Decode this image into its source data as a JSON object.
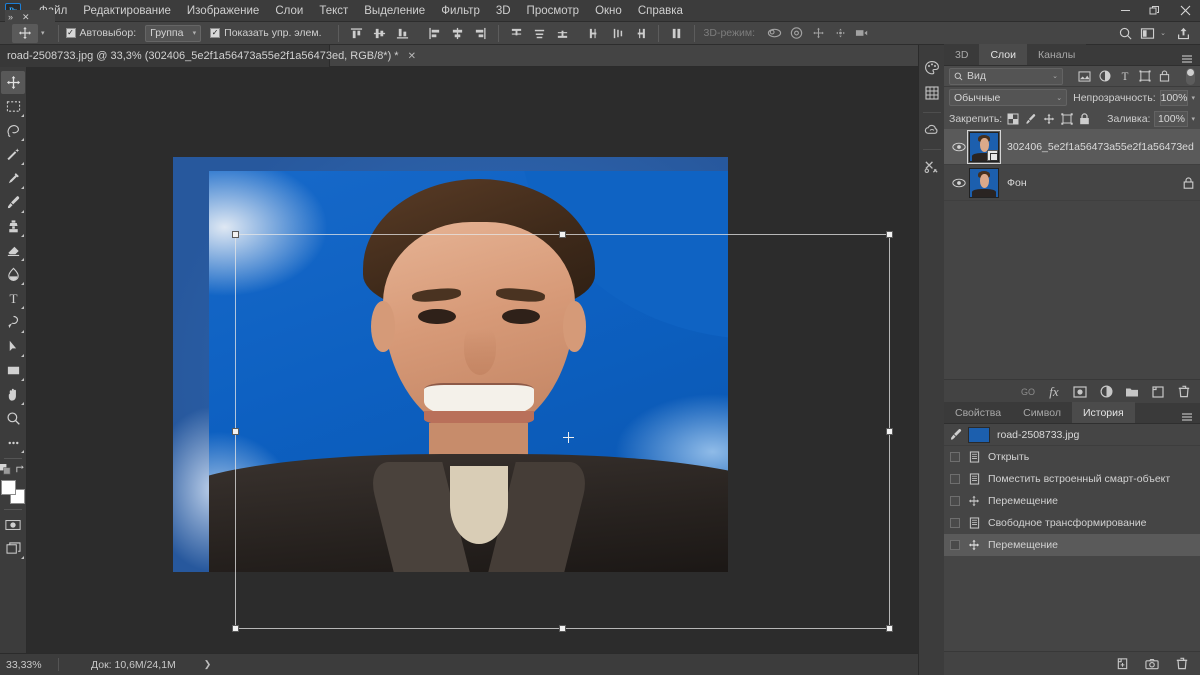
{
  "app": {
    "logo": "Ps"
  },
  "menubar": {
    "items": [
      "Файл",
      "Редактирование",
      "Изображение",
      "Слои",
      "Текст",
      "Выделение",
      "Фильтр",
      "3D",
      "Просмотр",
      "Окно",
      "Справка"
    ],
    "window_controls": {
      "minimize": "—",
      "restore": "❐",
      "close": "✕"
    }
  },
  "options_bar": {
    "tool_icon": "move-tool-icon",
    "auto_select_label": "Автовыбор:",
    "auto_select_checked": true,
    "auto_select_scope": "Группа",
    "show_controls_label": "Показать упр. элем.",
    "show_controls_checked": true,
    "align_icons": [
      "align-top-edges-icon",
      "align-vertical-centers-icon",
      "align-bottom-edges-icon",
      "align-left-edges-icon",
      "align-horizontal-centers-icon",
      "align-right-edges-icon"
    ],
    "distribute_icons": [
      "distribute-top-edges-icon",
      "distribute-vertical-centers-icon",
      "distribute-bottom-edges-icon",
      "distribute-left-edges-icon",
      "distribute-horizontal-centers-icon",
      "distribute-right-edges-icon"
    ],
    "arrange_icon": "arrange-icon",
    "mode_3d_label": "3D-режим:",
    "mode_3d_icons": [
      "orbit-3d-icon",
      "roll-3d-icon",
      "pan-3d-icon",
      "slide-3d-icon",
      "camera-3d-icon"
    ]
  },
  "header_right": {
    "search_icon": "search-icon",
    "workspace_icon": "workspace-switcher-icon",
    "workspace_caret": "⌄",
    "share_icon": "share-icon"
  },
  "document_tab": {
    "title": "road-2508733.jpg @ 33,3% (302406_5e2f1a56473a55e2f1a56473ed, RGB/8*) *",
    "close": "✕",
    "dock_expand": "»",
    "dock_close": "✕"
  },
  "toolbar": {
    "tools": [
      {
        "name": "move-tool",
        "active": true,
        "has_flyout": false
      },
      {
        "name": "rectangular-marquee-tool",
        "active": false,
        "has_flyout": true
      },
      {
        "name": "lasso-tool",
        "active": false,
        "has_flyout": true
      },
      {
        "name": "magic-wand-tool",
        "active": false,
        "has_flyout": true
      },
      {
        "name": "eyedropper-tool",
        "active": false,
        "has_flyout": true
      },
      {
        "name": "brush-tool",
        "active": false,
        "has_flyout": true
      },
      {
        "name": "clone-stamp-tool",
        "active": false,
        "has_flyout": true
      },
      {
        "name": "eraser-tool",
        "active": false,
        "has_flyout": true
      },
      {
        "name": "gradient-tool",
        "active": false,
        "has_flyout": true
      },
      {
        "name": "type-tool",
        "active": false,
        "has_flyout": true
      },
      {
        "name": "pen-tool",
        "active": false,
        "has_flyout": true
      },
      {
        "name": "path-selection-tool",
        "active": false,
        "has_flyout": true
      },
      {
        "name": "rectangle-tool",
        "active": false,
        "has_flyout": true
      },
      {
        "name": "hand-tool",
        "active": false,
        "has_flyout": true
      },
      {
        "name": "zoom-tool",
        "active": false,
        "has_flyout": false
      },
      {
        "name": "edit-toolbar-tool",
        "active": false,
        "has_flyout": false
      }
    ],
    "swap_colors_icon": "swap-colors-icon",
    "default_colors_icon": "default-colors-icon",
    "foreground_color": "#ffffff",
    "background_color": "#ffffff",
    "quick_mask_icon": "quick-mask-icon",
    "screen_mode_icon": "screen-mode-icon"
  },
  "canvas": {
    "transform_active": true,
    "center_mark": "transform-center-point"
  },
  "status_bar": {
    "zoom": "33,33%",
    "doc_info": "Док: 10,6M/24,1M",
    "arrow": "❯"
  },
  "icon_dock": {
    "items": [
      "color-panel-icon",
      "libraries-icon",
      "creative-cloud-icon",
      "tools-icon"
    ]
  },
  "layers_panel": {
    "tabs": [
      {
        "label": "3D",
        "active": false
      },
      {
        "label": "Слои",
        "active": true
      },
      {
        "label": "Каналы",
        "active": false
      }
    ],
    "menu_icon": "panel-menu-icon",
    "filter_value": "Вид",
    "filter_search_icon": "search-icon",
    "filter_caret": "⌄",
    "filter_icons": [
      "filter-pixel-icon",
      "filter-adjustment-icon",
      "filter-type-icon",
      "filter-shape-icon",
      "filter-smart-object-icon"
    ],
    "filter_toggle": "filter-enable-toggle",
    "blend_mode": "Обычные",
    "blend_caret": "⌄",
    "opacity_label": "Непрозрачность:",
    "opacity_value": "100%",
    "lock_label": "Закрепить:",
    "lock_icons": [
      "lock-transparent-pixels-icon",
      "lock-image-pixels-icon",
      "lock-position-icon",
      "lock-artboard-nesting-icon",
      "lock-all-icon"
    ],
    "fill_label": "Заливка:",
    "fill_value": "100%",
    "layers": [
      {
        "name": "302406_5e2f1a56473a55e2f1a56473ed",
        "visible": true,
        "selected": true,
        "smart_object": true,
        "locked": false
      },
      {
        "name": "Фон",
        "visible": true,
        "selected": false,
        "smart_object": false,
        "locked": true
      }
    ],
    "footer_icons": [
      "link-layers-icon",
      "layer-styles-icon",
      "layer-mask-icon",
      "adjustment-layer-icon",
      "new-group-icon",
      "new-layer-icon",
      "delete-layer-icon"
    ],
    "footer_link_label": "GO",
    "footer_fx_label": "fx"
  },
  "history_panel": {
    "tabs": [
      {
        "label": "Свойства",
        "active": false
      },
      {
        "label": "Символ",
        "active": false
      },
      {
        "label": "История",
        "active": true
      }
    ],
    "menu_icon": "panel-menu-icon",
    "snapshot": {
      "name": "road-2508733.jpg",
      "brush_icon": "history-brush-source-icon"
    },
    "states": [
      {
        "label": "Открыть",
        "icon": "open-document-icon",
        "selected": false
      },
      {
        "label": "Поместить встроенный смарт-объект",
        "icon": "place-embedded-icon",
        "selected": false
      },
      {
        "label": "Перемещение",
        "icon": "move-state-icon",
        "selected": false
      },
      {
        "label": "Свободное трансформирование",
        "icon": "free-transform-icon",
        "selected": false
      },
      {
        "label": "Перемещение",
        "icon": "move-state-icon",
        "selected": true
      }
    ],
    "footer_icons": [
      "create-document-from-state-icon",
      "create-snapshot-icon",
      "delete-state-icon"
    ]
  },
  "colors": {
    "accent": "#31a8ff",
    "panel_bg": "#434343",
    "canvas_bg": "#2c2c2c",
    "selected_row": "#5a5a5a"
  }
}
